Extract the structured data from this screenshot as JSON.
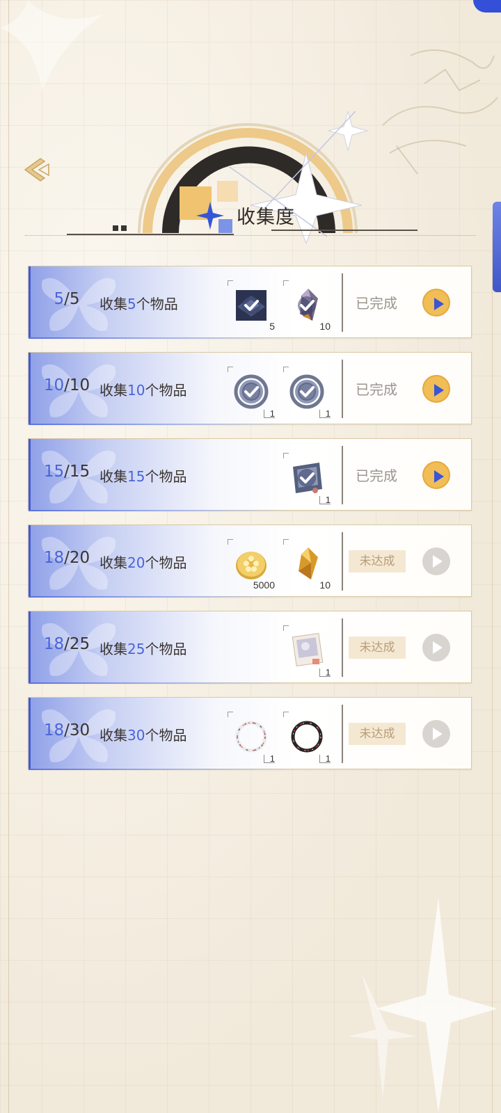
{
  "page": {
    "title": "收集度"
  },
  "colors": {
    "accent_blue": "#4a64d8",
    "gold": "#f0bd57",
    "status_done": "#9b958d",
    "status_pending_bg": "#f5e8d3"
  },
  "tasks": [
    {
      "current": "5",
      "total": "/5",
      "desc_pre": "收集",
      "desc_num": "5",
      "desc_post": "个物品",
      "status": "已完成",
      "status_type": "done",
      "rewards": [
        {
          "icon": "dark-crystal-box-icon",
          "qty": "5",
          "claimed": true
        },
        {
          "icon": "crystal-shard-icon",
          "qty": "10",
          "claimed": true
        }
      ]
    },
    {
      "current": "10",
      "total": "/10",
      "desc_pre": "收集",
      "desc_num": "10",
      "desc_post": "个物品",
      "status": "已完成",
      "status_type": "done",
      "rewards": [
        {
          "icon": "silver-ring-icon",
          "qty": "1",
          "claimed": true
        },
        {
          "icon": "silver-ring-icon",
          "qty": "1",
          "claimed": true
        }
      ]
    },
    {
      "current": "15",
      "total": "/15",
      "desc_pre": "收集",
      "desc_num": "15",
      "desc_post": "个物品",
      "status": "已完成",
      "status_type": "done",
      "rewards": [
        {
          "icon": "photo-frame-icon",
          "qty": "1",
          "claimed": true
        }
      ]
    },
    {
      "current": "18",
      "total": "/20",
      "desc_pre": "收集",
      "desc_num": "20",
      "desc_post": "个物品",
      "status": "未达成",
      "status_type": "pending",
      "rewards": [
        {
          "icon": "gold-coin-icon",
          "qty": "5000",
          "claimed": false
        },
        {
          "icon": "gold-crystal-icon",
          "qty": "10",
          "claimed": false
        }
      ]
    },
    {
      "current": "18",
      "total": "/25",
      "desc_pre": "收集",
      "desc_num": "25",
      "desc_post": "个物品",
      "status": "未达成",
      "status_type": "pending",
      "rewards": [
        {
          "icon": "photo-card-icon",
          "qty": "1",
          "claimed": false
        }
      ]
    },
    {
      "current": "18",
      "total": "/30",
      "desc_pre": "收集",
      "desc_num": "30",
      "desc_post": "个物品",
      "status": "未达成",
      "status_type": "pending",
      "rewards": [
        {
          "icon": "white-wreath-icon",
          "qty": "1",
          "claimed": false
        },
        {
          "icon": "black-wreath-icon",
          "qty": "1",
          "claimed": false
        }
      ]
    }
  ]
}
